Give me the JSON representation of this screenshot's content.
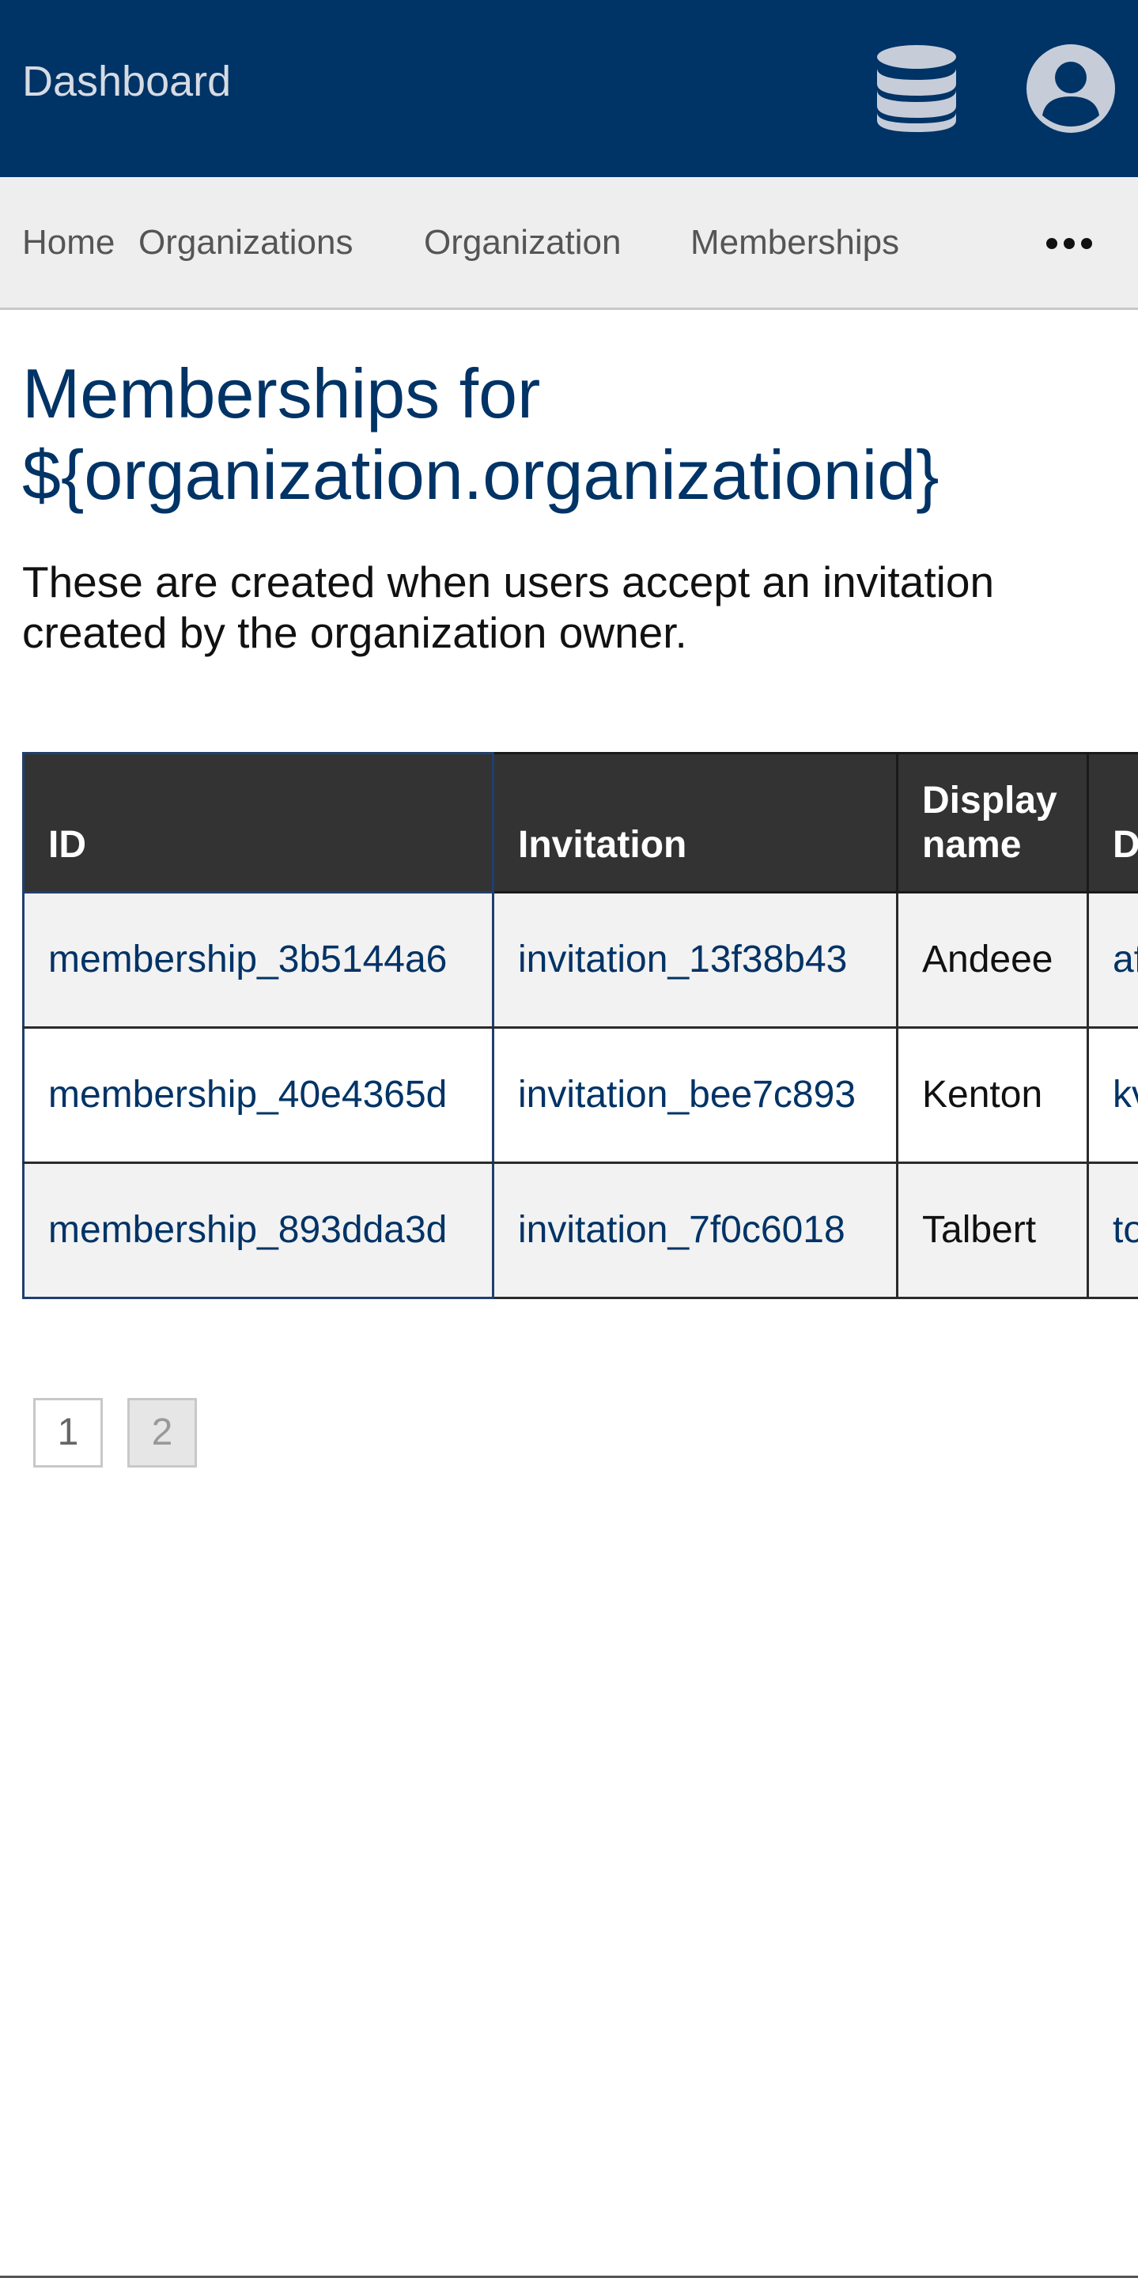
{
  "header": {
    "brand": "Dashboard",
    "icons": [
      "database-icon",
      "user-icon"
    ],
    "background_color": "#003366"
  },
  "nav": {
    "links": [
      "Home",
      "Organizations",
      "Organization",
      "Memberships"
    ],
    "more_icon": "ellipsis-icon"
  },
  "main": {
    "title_line1": "Memberships for",
    "title_line2": "${organization.organizationid}",
    "intro": "These are created when users accept an invitation created by the organization owner."
  },
  "table": {
    "headers": [
      "ID",
      "Invitation",
      "Display name",
      "D"
    ],
    "rows": [
      {
        "id": "membership_3b5144a6",
        "invitation": "invitation_13f38b43",
        "display_name": "Andeee",
        "col4": "af"
      },
      {
        "id": "membership_40e4365d",
        "invitation": "invitation_bee7c893",
        "display_name": "Kenton",
        "col4": "kv"
      },
      {
        "id": "membership_893dda3d",
        "invitation": "invitation_7f0c6018",
        "display_name": "Talbert",
        "col4": "to m"
      }
    ]
  },
  "pagination": {
    "pages": [
      "1",
      "2"
    ],
    "current": "1"
  }
}
